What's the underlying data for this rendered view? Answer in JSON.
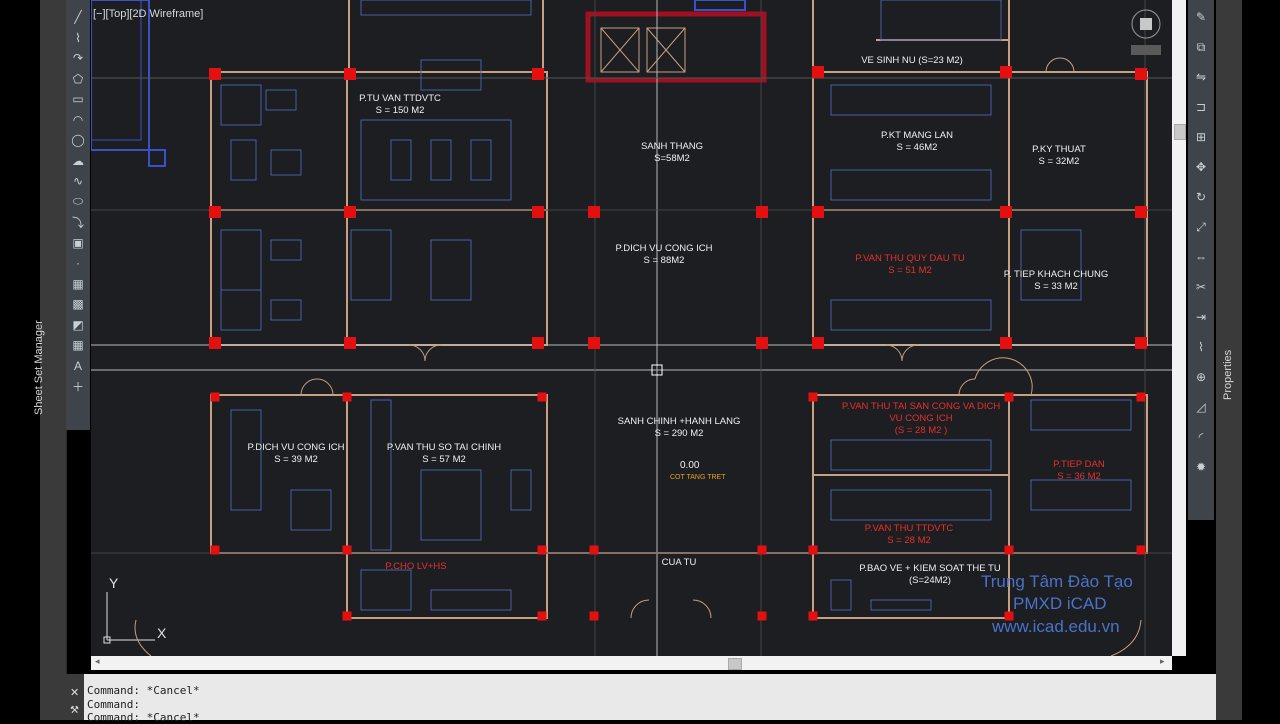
{
  "viewport": {
    "label": "[−][Top][2D Wireframe]"
  },
  "side_panels": {
    "left": "Sheet Set Manager",
    "right": "Properties"
  },
  "rooms": [
    {
      "name": "P.TU VAN TTDVTC",
      "area": "S = 150 M2",
      "red": false
    },
    {
      "name": "SANH THANG",
      "area": "S=58M2",
      "red": false
    },
    {
      "name": "VE SINH NU (S=23 M2)",
      "area": "",
      "red": false
    },
    {
      "name": "P.KT MANG LAN",
      "area": "S = 46M2",
      "red": false
    },
    {
      "name": "P.KY THUAT",
      "area": "S = 32M2",
      "red": false
    },
    {
      "name": "P.DICH VU CONG ICH",
      "area": "S = 88M2",
      "red": false
    },
    {
      "name": "P.VAN THU QUY DAU TU",
      "area": "S = 51 M2",
      "red": true
    },
    {
      "name": "P. TIEP KHACH CHUNG",
      "area": "S = 33 M2",
      "red": false
    },
    {
      "name": "P.DICH VU CONG ICH",
      "area": "S = 39 M2",
      "red": false
    },
    {
      "name": "P.VAN THU SO TAI CHINH",
      "area": "S = 57 M2",
      "red": false
    },
    {
      "name": "SANH CHINH +HANH LANG",
      "area": "S = 290 M2",
      "red": false
    },
    {
      "name": "P.VAN THU TAI SAN CONG VA DICH VU CONG ICH",
      "area": "(S = 28 M2 )",
      "red": true
    },
    {
      "name": "P.TIEP DAN",
      "area": "S = 36 M2",
      "red": true
    },
    {
      "name": "P.VAN THU TTDVTC",
      "area": "S = 28 M2",
      "red": true
    },
    {
      "name": "P.CHO LV+HS",
      "area": "",
      "red": true
    },
    {
      "name": "CUA TU",
      "area": "",
      "red": false
    },
    {
      "name": "P.BAO VE + KIEM SOAT THE TU",
      "area": "(S=24M2)",
      "red": false
    }
  ],
  "level": {
    "value": "0.00",
    "label": "COT TANG TRET"
  },
  "ucs": {
    "x": "X",
    "y": "Y"
  },
  "watermark": {
    "line1": "Trung Tâm Đào Tạo",
    "line2": "PMXD iCAD",
    "line3": "www.icad.edu.vn"
  },
  "command_lines": [
    "Command: *Cancel*",
    "Command:",
    "Command: *Cancel*"
  ],
  "colors": {
    "column": "#e41010",
    "wall": "#c8a080",
    "canvas": "#1c1e22",
    "grid": "#d0d0d0",
    "furniture": "#4a5fa8"
  },
  "draw_tools": [
    "line-icon",
    "polyline-icon",
    "arc-icon",
    "polygon-icon",
    "rectangle-icon",
    "arc2-icon",
    "circle-icon",
    "cloud-icon",
    "spline-icon",
    "ellipse-icon",
    "insert-icon",
    "block-icon",
    "point-icon",
    "hatch-icon",
    "gradient-icon",
    "region-icon",
    "table-icon",
    "text-icon",
    "add-icon"
  ],
  "modify_tools": [
    "erase-icon",
    "copy-icon",
    "mirror-icon",
    "offset-icon",
    "array-icon",
    "move-icon",
    "rotate-icon",
    "scale-icon",
    "stretch-icon",
    "trim-icon",
    "extend-icon",
    "break-icon",
    "join-icon",
    "chamfer-icon",
    "fillet-icon",
    "explode-icon"
  ]
}
